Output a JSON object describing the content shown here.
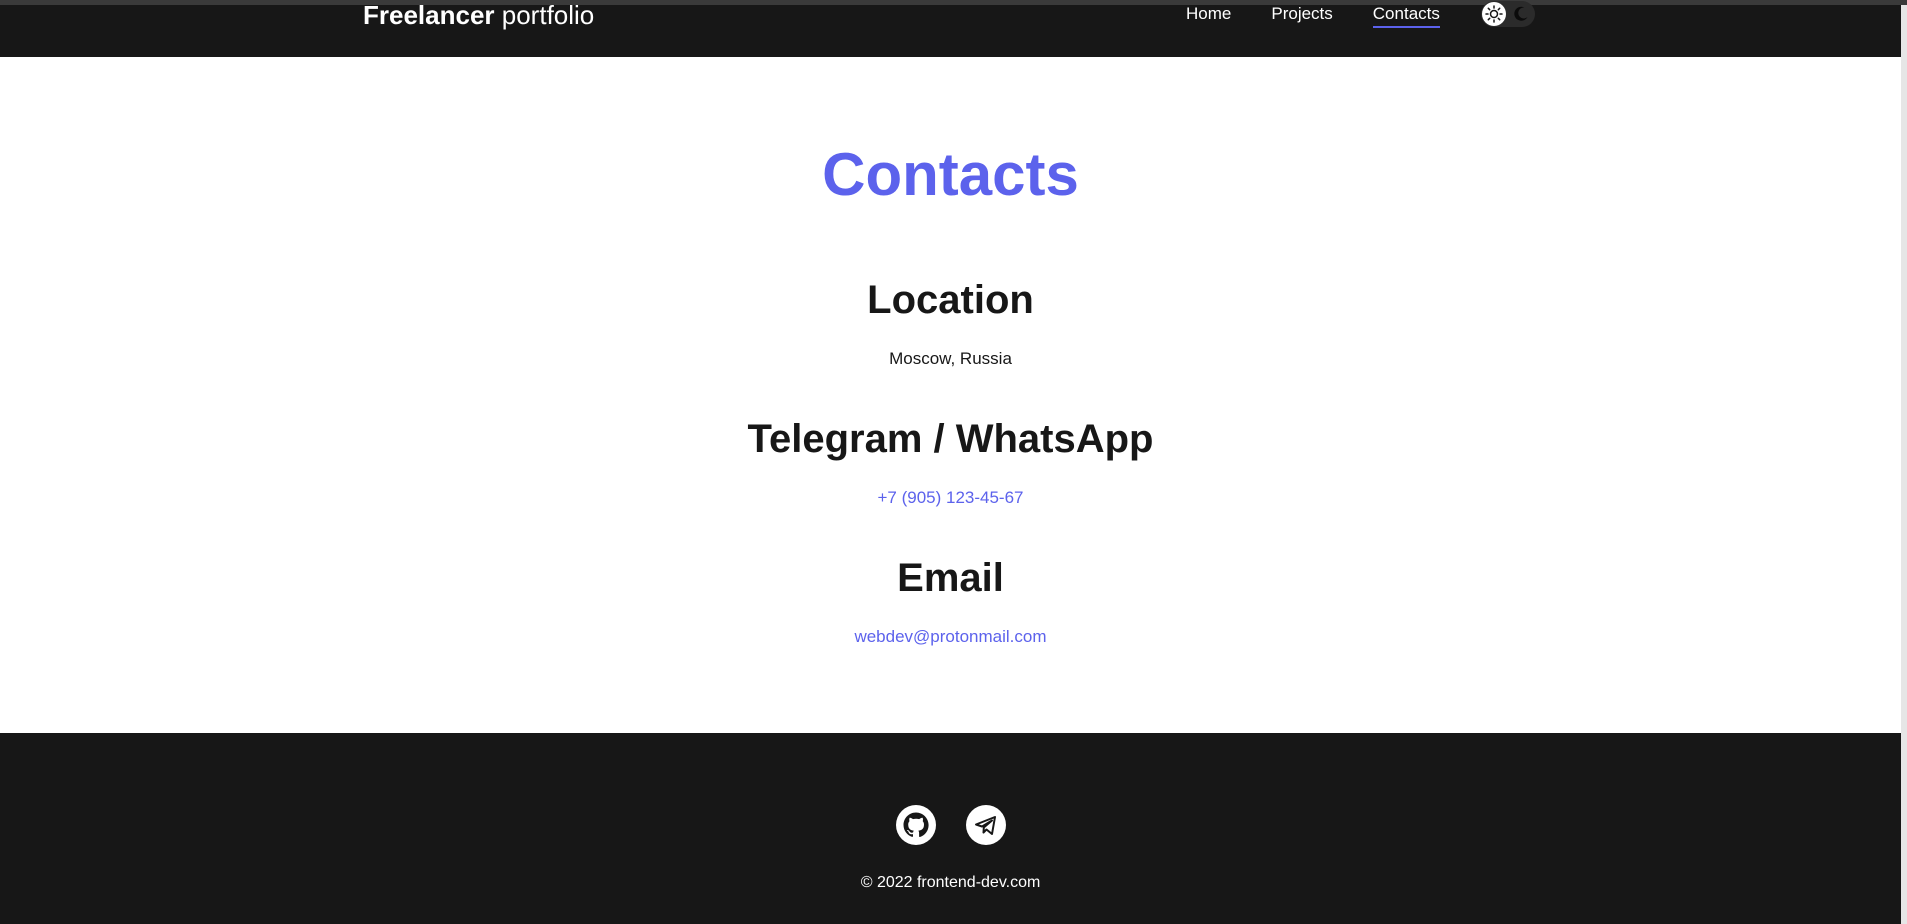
{
  "header": {
    "logo_bold": "Freelancer",
    "logo_light": "portfolio",
    "nav": {
      "home": "Home",
      "projects": "Projects",
      "contacts": "Contacts"
    },
    "active_nav": "Contacts"
  },
  "main": {
    "title": "Contacts",
    "sections": [
      {
        "title": "Location",
        "value": "Moscow, Russia"
      },
      {
        "title": "Telegram / WhatsApp",
        "value": "+7 (905) 123-45-67"
      },
      {
        "title": "Email",
        "value": "webdev@protonmail.com"
      }
    ]
  },
  "footer": {
    "social_icons": [
      "github-icon",
      "telegram-icon"
    ],
    "copyright": "© 2022 frontend-dev.com"
  },
  "colors": {
    "accent": "#5c62ec",
    "dark": "#171717",
    "text": "#171717",
    "white": "#ffffff"
  }
}
